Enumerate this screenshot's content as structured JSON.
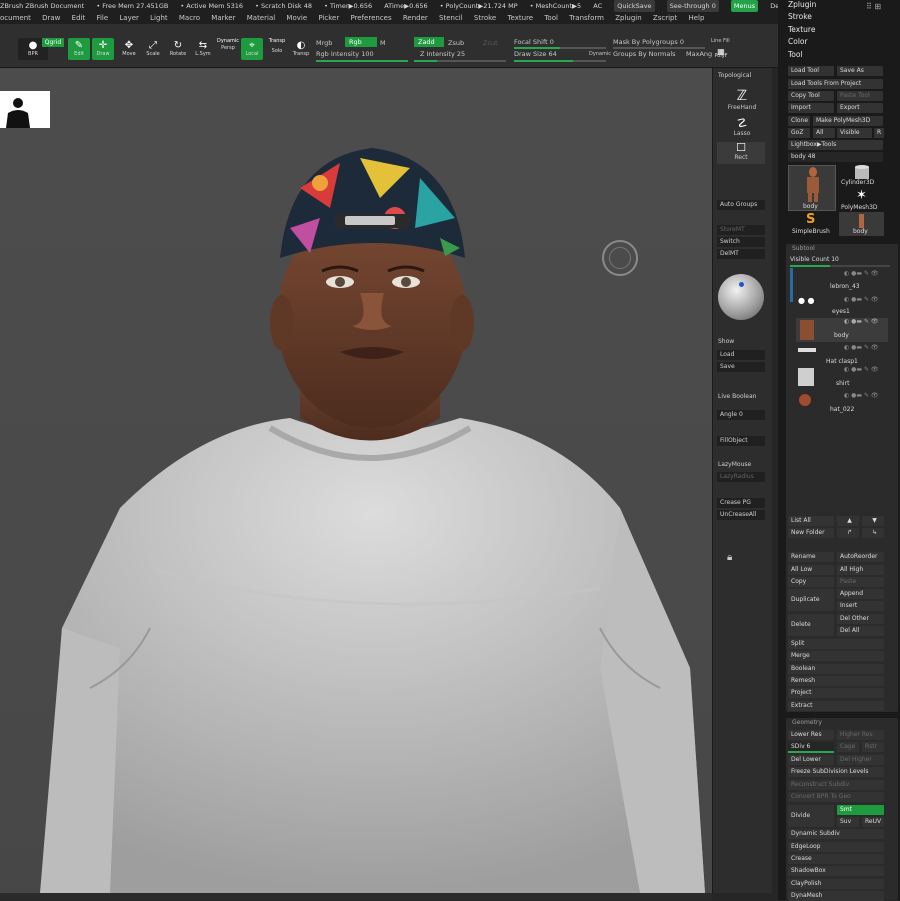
{
  "header": {
    "title": "ZBrush ZBrush Document",
    "free_mem": "• Free Mem 27.451GB",
    "active_mem": "• Active Mem 5316",
    "scratch": "• Scratch Disk 48",
    "timer": "• Timer▶0.656",
    "atime": "ATime▶0.656",
    "polycount": "• PolyCount▶21.724 MP",
    "meshcount": "• MeshCount▶5",
    "ac": "AC",
    "quicksave": "QuickSave",
    "seethrough": "See-through 0",
    "menus": "Menus",
    "default_zscript": "DefaultZScript"
  },
  "menubar": [
    "ocument",
    "Draw",
    "Edit",
    "File",
    "Layer",
    "Light",
    "Macro",
    "Marker",
    "Material",
    "Movie",
    "Picker",
    "Preferences",
    "Render",
    "Stencil",
    "Stroke",
    "Texture",
    "Tool",
    "Transform",
    "Zplugin",
    "Zscript",
    "Help"
  ],
  "toolbar": {
    "bpr": "BPR",
    "qgrid": "Qgrid",
    "edit": "Edit",
    "draw": "Draw",
    "move": "Move",
    "scale": "Scale",
    "rotate": "Rotate",
    "lsym": "L.Sym",
    "dynamic": "Dynamic",
    "persp": "Persp",
    "floor": "Floor",
    "local": "Local",
    "solo": "Solo",
    "transp": "Transp",
    "mrgb": "Mrgb",
    "rgb": "Rgb",
    "m": "M",
    "rgb_intensity": "Rgb Intensity 100",
    "zadd": "Zadd",
    "zsub": "Zsub",
    "zcut": "Zcut",
    "z_intensity": "Z Intensity 25",
    "focal_shift": "Focal Shift 0",
    "draw_size": "Draw Size 64",
    "dynamic2": "Dynamic",
    "mask_polygroups": "Mask By Polygroups 0",
    "groups_normals": "Groups By Normals",
    "maxangle": "MaxAng",
    "line_fill": "Line Fill",
    "polyf": "PolyF",
    "rgb_intensity_val": 1.0,
    "z_intensity_val": 0.25,
    "draw_size_val": 0.64
  },
  "left_shelf": {
    "topological": "Topological",
    "freehand": "FreeHand",
    "lasso": "Lasso",
    "rect": "Rect",
    "auto_groups": "Auto Groups",
    "storemt": "StoreMT",
    "switch": "Switch",
    "delmt": "DelMT",
    "show": "Show",
    "load": "Load",
    "save": "Save",
    "live_boolean": "Live Boolean",
    "angle": "Angle 0",
    "fillobject": "FillObject",
    "lazymouse": "LazyMouse",
    "lazyradius": "LazyRadius",
    "crease_pg": "Crease PG",
    "uncreaseall": "UnCreaseAll"
  },
  "right_menu": [
    "Zplugin",
    "Stroke",
    "Texture",
    "Color",
    "Tool"
  ],
  "tool_panel": {
    "load_tool": "Load Tool",
    "save_as": "Save As",
    "load_from_project": "Load Tools From Project",
    "copy_tool": "Copy Tool",
    "paste_tool": "Paste Tool",
    "import": "Import",
    "export": "Export",
    "clone": "Clone",
    "make_polymesh": "Make PolyMesh3D",
    "goz": "GoZ",
    "all": "All",
    "visible": "Visible",
    "r": "R",
    "lightbox_tools": "Lightbox▶Tools",
    "body_48": "body  48",
    "thumbs": [
      {
        "label": "body"
      },
      {
        "label": "Cylinder3D"
      },
      {
        "label": "body"
      },
      {
        "label": "PolyMesh3D"
      },
      {
        "label": "SimpleBrush"
      },
      {
        "label": "body"
      }
    ]
  },
  "subtool": {
    "title": "Subtool",
    "visible_count": "Visible Count 10",
    "items": [
      "lebron_43",
      "eyes1",
      "body",
      "Hat clasp1",
      "shirt",
      "hat_022"
    ]
  },
  "subtool_actions": {
    "list_all": "List All",
    "new_folder": "New Folder",
    "rename": "Rename",
    "autoreorder": "AutoReorder",
    "all_low": "All Low",
    "all_high": "All High",
    "copy": "Copy",
    "paste": "Paste",
    "duplicate": "Duplicate",
    "append": "Append",
    "insert": "Insert",
    "delete": "Delete",
    "del_other": "Del Other",
    "del_all": "Del All",
    "split": "Split",
    "merge": "Merge",
    "boolean": "Boolean",
    "remesh": "Remesh",
    "project": "Project",
    "extract": "Extract"
  },
  "geometry": {
    "title": "Geometry",
    "lower_res": "Lower Res",
    "higher_res": "Higher Res",
    "sdiv": "SDiv 6",
    "cage": "Cage",
    "rstr": "Rstr",
    "del_lower": "Del Lower",
    "del_higher": "Del Higher",
    "freeze": "Freeze SubDivision Levels",
    "reconstruct": "Reconstruct Subdiv",
    "convert_bpr": "Convert BPR To Geo",
    "divide": "Divide",
    "smt": "Smt",
    "suv": "Suv",
    "reuv": "ReUV",
    "dynamic_subdiv": "Dynamic Subdiv",
    "edgeloop": "EdgeLoop",
    "crease": "Crease",
    "shadowbox": "ShadowBox",
    "clayfolish": "ClayPolish",
    "dynamesh": "DynaMesh"
  },
  "colors": {
    "accent_green": "#1e9a3f",
    "highlight_blue": "#2a6aa3",
    "canvas_bg": "#4a4a4a",
    "panel_bg": "#1a1a1a"
  }
}
